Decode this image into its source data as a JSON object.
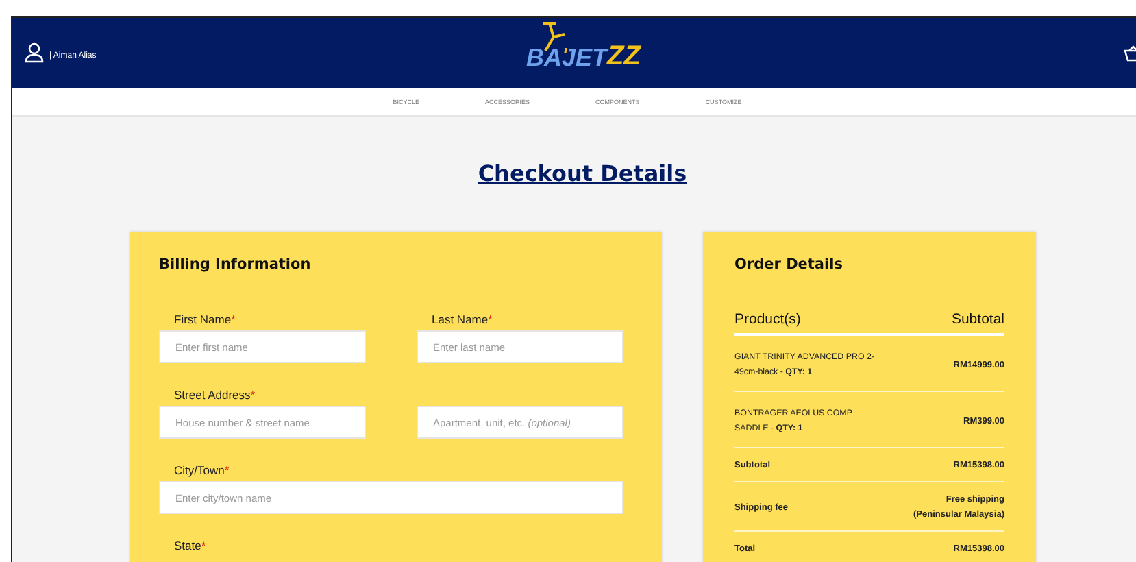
{
  "header": {
    "user": "| Aiman Alias",
    "logo": {
      "word": "BAJET",
      "mark": "ZZ"
    }
  },
  "nav": [
    "BICYCLE",
    "ACCESSORIES",
    "COMPONENTS",
    "CUSTOMIZE"
  ],
  "title": "Checkout Details",
  "billing": {
    "title": "Billing Information",
    "rows": [
      [
        {
          "label": "First Name",
          "mark": "*",
          "placeholder": "Enter first name"
        },
        {
          "label": "Last Name",
          "mark": "*",
          "placeholder": "Enter last name"
        }
      ],
      [
        {
          "label": "Street Address",
          "mark": "*",
          "placeholder": "House number & street name"
        },
        {
          "placeholder": "Apartment, unit, etc. *(optional)*"
        }
      ],
      [
        {
          "label": "City/Town",
          "mark": "*",
          "placeholder": "Enter city/town name"
        }
      ],
      [
        {
          "label": "State",
          "mark": "*"
        }
      ]
    ]
  },
  "order": {
    "title": "Order Details",
    "columns": [
      "Product(s)",
      "Subtotal"
    ],
    "rows": [
      {
        "kind": "product",
        "name": "GIANT TRINITY ADVANCED PRO 2-49cm-black - **QTY: 1**",
        "value": "RM14999.00"
      },
      {
        "kind": "product",
        "name": "BONTRAGER AEOLUS COMP SADDLE - **QTY: 1**",
        "value": "RM399.00"
      },
      {
        "kind": "summary",
        "name": "Subtotal",
        "value": "RM15398.00"
      },
      {
        "kind": "summary",
        "name": "Shipping fee",
        "value": "Free shipping\n(Peninsular Malaysia)"
      },
      {
        "kind": "summary",
        "name": "Total",
        "value": "RM15398.00"
      }
    ]
  }
}
